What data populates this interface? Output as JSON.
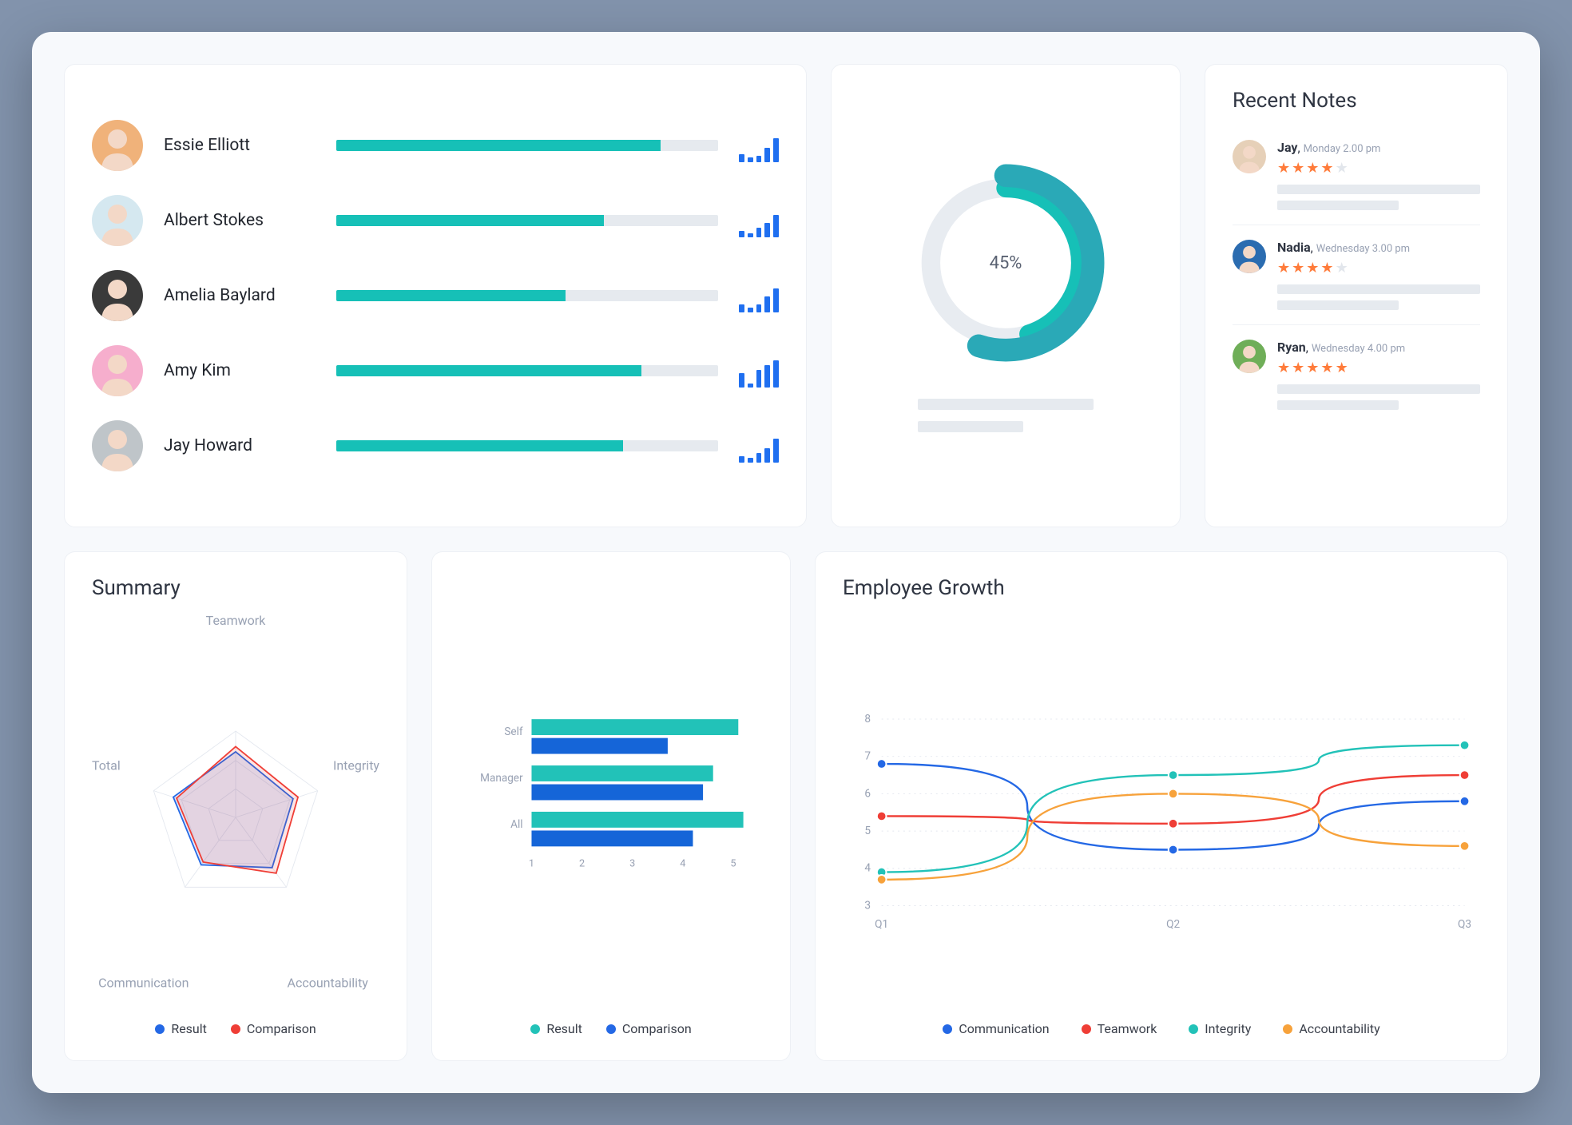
{
  "colors": {
    "teal": "#16c0b7",
    "blue": "#1565d8",
    "red": "#ef3e36",
    "orange": "#f7a23b"
  },
  "people": [
    {
      "name": "Essie Elliott",
      "progress": 85,
      "avatar_bg": "#f0b27a",
      "bars": [
        10,
        6,
        8,
        18,
        30
      ]
    },
    {
      "name": "Albert Stokes",
      "progress": 70,
      "avatar_bg": "#d5e8f0",
      "bars": [
        8,
        5,
        12,
        18,
        28
      ]
    },
    {
      "name": "Amelia Baylard",
      "progress": 60,
      "avatar_bg": "#3a3a3a",
      "bars": [
        10,
        6,
        10,
        20,
        30
      ]
    },
    {
      "name": "Amy Kim",
      "progress": 80,
      "avatar_bg": "#f6aecd",
      "bars": [
        18,
        5,
        22,
        28,
        34
      ]
    },
    {
      "name": "Jay Howard",
      "progress": 75,
      "avatar_bg": "#bfc5c9",
      "bars": [
        8,
        6,
        12,
        18,
        30
      ]
    }
  ],
  "donut": {
    "percent": 45,
    "label": "45%"
  },
  "notes": {
    "title": "Recent Notes",
    "items": [
      {
        "name": "Jay",
        "ts": "Monday 2.00 pm",
        "stars": 4,
        "avatar_bg": "#e6d0b8"
      },
      {
        "name": "Nadia",
        "ts": "Wednesday 3.00 pm",
        "stars": 4,
        "avatar_bg": "#2b6cb0"
      },
      {
        "name": "Ryan",
        "ts": "Wednesday 4.00 pm",
        "stars": 5,
        "avatar_bg": "#6fae58"
      }
    ]
  },
  "summary": {
    "title": "Summary",
    "axes": [
      "Teamwork",
      "Integrity",
      "Accountability",
      "Communication",
      "Total"
    ],
    "result_label": "Result",
    "comparison_label": "Comparison"
  },
  "bar_chart": {
    "result_label": "Result",
    "comparison_label": "Comparison"
  },
  "growth": {
    "title": "Employee Growth",
    "legend": {
      "communication": "Communication",
      "teamwork": "Teamwork",
      "integrity": "Integrity",
      "accountability": "Accountability"
    }
  },
  "chart_data": [
    {
      "id": "donut",
      "type": "pie",
      "title": "",
      "value_percent": 45
    },
    {
      "id": "summary_radar",
      "type": "radar",
      "title": "Summary",
      "categories": [
        "Teamwork",
        "Integrity",
        "Accountability",
        "Communication",
        "Total"
      ],
      "max": 5,
      "series": [
        {
          "name": "Result",
          "color": "#2468e5",
          "values": [
            3.8,
            3.5,
            3.6,
            3.4,
            3.8
          ]
        },
        {
          "name": "Comparison",
          "color": "#ef3e36",
          "values": [
            4.1,
            3.8,
            4.0,
            3.2,
            3.6
          ]
        }
      ]
    },
    {
      "id": "horizontal_bar",
      "type": "bar",
      "orientation": "horizontal",
      "categories": [
        "Self",
        "Manager",
        "All"
      ],
      "xlim": [
        1,
        5
      ],
      "xticks": [
        1,
        2,
        3,
        4,
        5
      ],
      "series": [
        {
          "name": "Result",
          "color": "#22c2b8",
          "values": [
            5.1,
            4.6,
            5.2
          ]
        },
        {
          "name": "Comparison",
          "color": "#1565d8",
          "values": [
            3.7,
            4.4,
            4.2
          ]
        }
      ]
    },
    {
      "id": "employee_growth",
      "type": "line",
      "title": "Employee Growth",
      "x": [
        "Q1",
        "Q2",
        "Q3"
      ],
      "ylim": [
        3,
        8
      ],
      "yticks": [
        3,
        4,
        5,
        6,
        7,
        8
      ],
      "series": [
        {
          "name": "Communication",
          "color": "#2468e5",
          "values": [
            6.8,
            4.5,
            5.8
          ]
        },
        {
          "name": "Teamwork",
          "color": "#ef3e36",
          "values": [
            5.4,
            5.2,
            6.5
          ]
        },
        {
          "name": "Integrity",
          "color": "#22c2b8",
          "values": [
            3.9,
            6.5,
            7.3
          ]
        },
        {
          "name": "Accountability",
          "color": "#f7a23b",
          "values": [
            3.7,
            6.0,
            4.6
          ]
        }
      ]
    }
  ]
}
